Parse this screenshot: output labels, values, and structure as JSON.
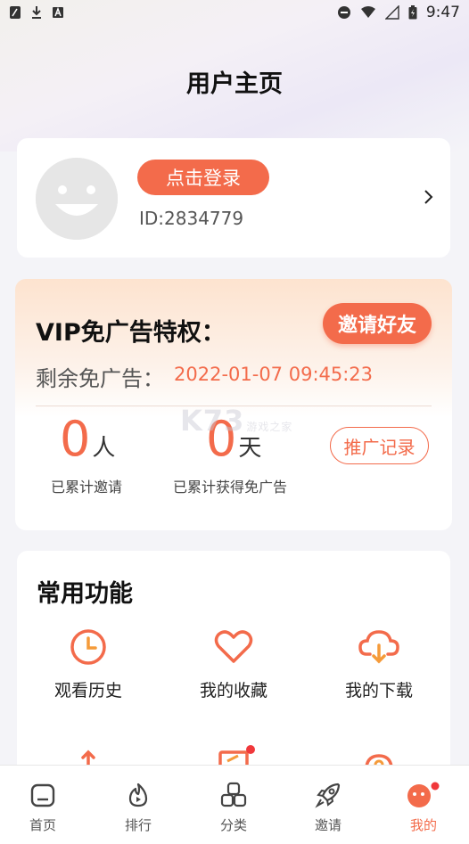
{
  "status_bar": {
    "time": "9:47"
  },
  "page_title": "用户主页",
  "profile": {
    "login_label": "点击登录",
    "user_id": "ID:2834779"
  },
  "vip": {
    "title": "VIP免广告特权：",
    "invite_label": "邀请好友",
    "remain_label": "剩余免广告：",
    "remain_time": "2022-01-07 09:45:23",
    "invited_count": "0",
    "invited_unit": "人",
    "invited_label": "已累计邀请",
    "days_count": "0",
    "days_unit": "天",
    "days_label": "已累计获得免广告",
    "record_label": "推广记录"
  },
  "watermark": {
    "brand": "K73",
    "sub": "游戏之家"
  },
  "functions": {
    "title": "常用功能",
    "items": [
      {
        "label": "观看历史",
        "icon": "clock-icon"
      },
      {
        "label": "我的收藏",
        "icon": "heart-icon"
      },
      {
        "label": "我的下载",
        "icon": "cloud-download-icon"
      }
    ]
  },
  "tabbar": {
    "items": [
      {
        "label": "首页",
        "icon": "home-icon"
      },
      {
        "label": "排行",
        "icon": "fire-icon"
      },
      {
        "label": "分类",
        "icon": "grid-icon"
      },
      {
        "label": "邀请",
        "icon": "rocket-icon"
      },
      {
        "label": "我的",
        "icon": "profile-face-icon"
      }
    ],
    "active_index": 4
  },
  "colors": {
    "accent": "#f36b4b",
    "badge": "#f0383b"
  }
}
